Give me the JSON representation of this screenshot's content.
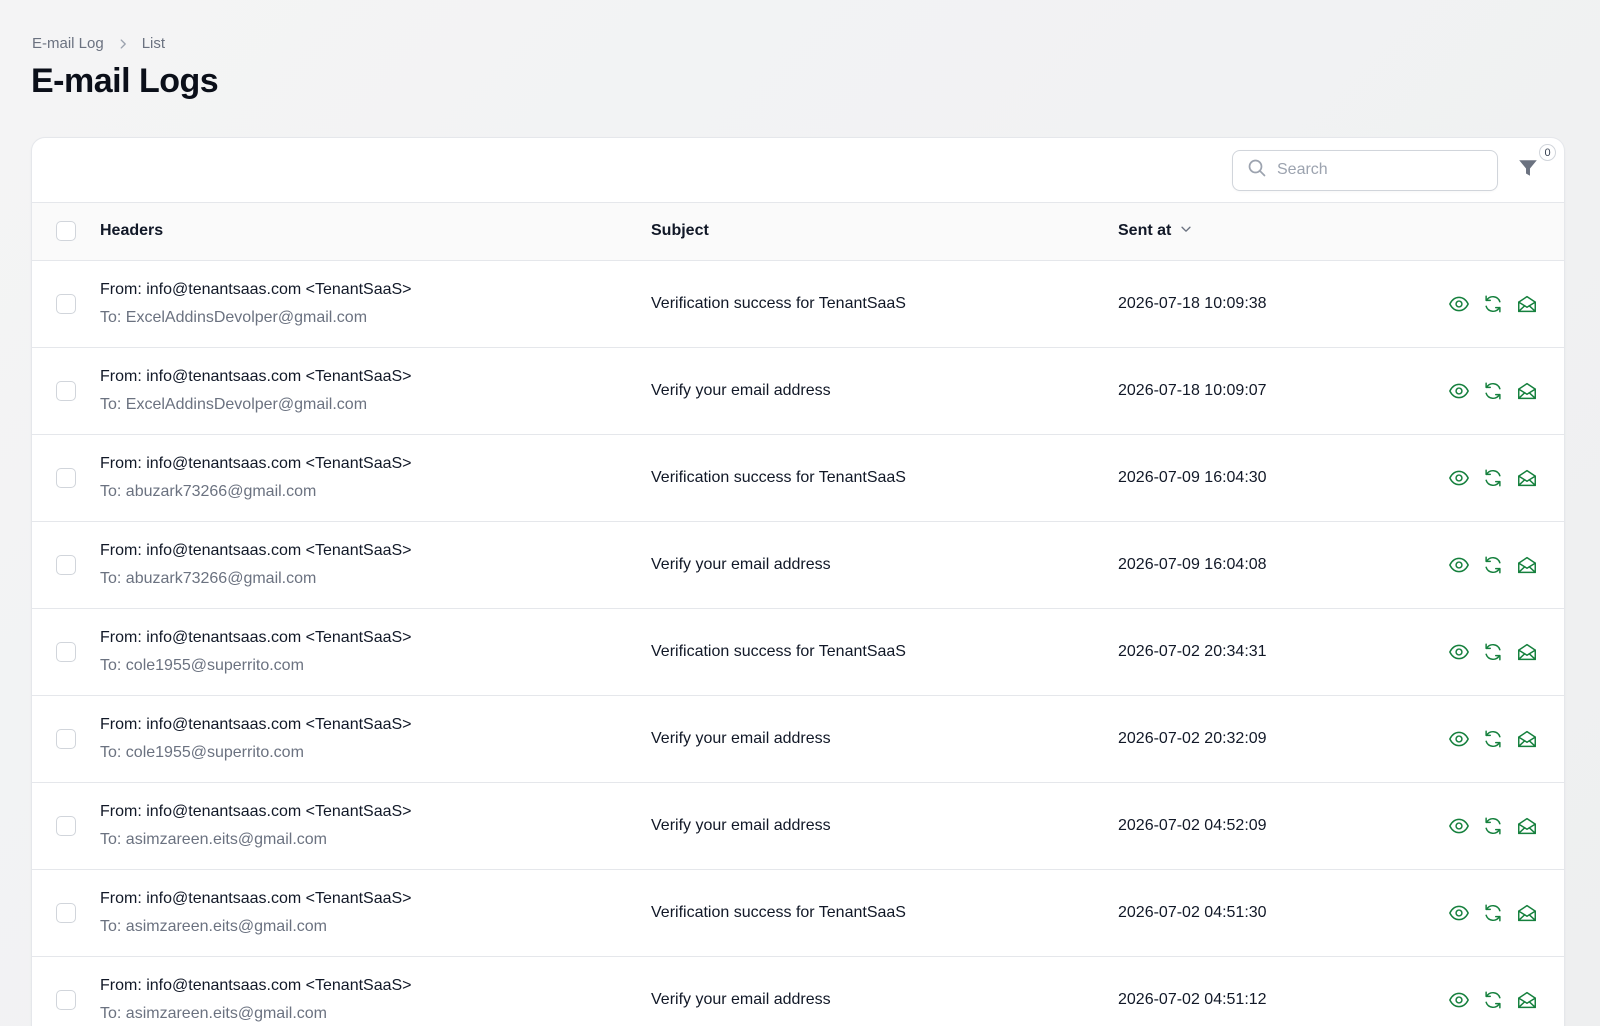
{
  "breadcrumb": {
    "parent": "E-mail Log",
    "current": "List"
  },
  "page": {
    "title": "E-mail Logs"
  },
  "toolbar": {
    "search_placeholder": "Search",
    "filter_count": "0"
  },
  "columns": {
    "headers": "Headers",
    "subject": "Subject",
    "sent_at": "Sent at"
  },
  "colors": {
    "accent": "#15803d",
    "border": "#e5e7eb",
    "muted": "#6b7280"
  },
  "icons": {
    "view": "eye-icon",
    "resend": "refresh-icon",
    "open": "envelope-open-icon"
  },
  "rows": [
    {
      "from": "From: info@tenantsaas.com <TenantSaaS>",
      "to": "To: ExcelAddinsDevolper@gmail.com",
      "subject": "Verification success for TenantSaaS",
      "sent_at": "2026-07-18 10:09:38"
    },
    {
      "from": "From: info@tenantsaas.com <TenantSaaS>",
      "to": "To: ExcelAddinsDevolper@gmail.com",
      "subject": "Verify your email address",
      "sent_at": "2026-07-18 10:09:07"
    },
    {
      "from": "From: info@tenantsaas.com <TenantSaaS>",
      "to": "To: abuzark73266@gmail.com",
      "subject": "Verification success for TenantSaaS",
      "sent_at": "2026-07-09 16:04:30"
    },
    {
      "from": "From: info@tenantsaas.com <TenantSaaS>",
      "to": "To: abuzark73266@gmail.com",
      "subject": "Verify your email address",
      "sent_at": "2026-07-09 16:04:08"
    },
    {
      "from": "From: info@tenantsaas.com <TenantSaaS>",
      "to": "To: cole1955@superrito.com",
      "subject": "Verification success for TenantSaaS",
      "sent_at": "2026-07-02 20:34:31"
    },
    {
      "from": "From: info@tenantsaas.com <TenantSaaS>",
      "to": "To: cole1955@superrito.com",
      "subject": "Verify your email address",
      "sent_at": "2026-07-02 20:32:09"
    },
    {
      "from": "From: info@tenantsaas.com <TenantSaaS>",
      "to": "To: asimzareen.eits@gmail.com",
      "subject": "Verify your email address",
      "sent_at": "2026-07-02 04:52:09"
    },
    {
      "from": "From: info@tenantsaas.com <TenantSaaS>",
      "to": "To: asimzareen.eits@gmail.com",
      "subject": "Verification success for TenantSaaS",
      "sent_at": "2026-07-02 04:51:30"
    },
    {
      "from": "From: info@tenantsaas.com <TenantSaaS>",
      "to": "To: asimzareen.eits@gmail.com",
      "subject": "Verify your email address",
      "sent_at": "2026-07-02 04:51:12"
    }
  ]
}
